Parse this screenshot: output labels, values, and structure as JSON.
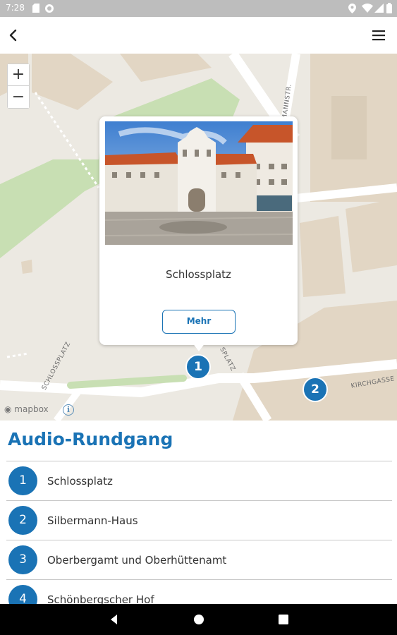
{
  "status_bar": {
    "time": "7:28"
  },
  "map": {
    "streets": [
      "SCHLOSSPLATZ",
      "SPLATZ",
      "KIRCHGASSE",
      "RMANNSTR."
    ],
    "attribution": "mapbox",
    "markers": [
      {
        "label": "1"
      },
      {
        "label": "2"
      }
    ]
  },
  "popup": {
    "title": "Schlossplatz",
    "more_label": "Mehr"
  },
  "tour": {
    "title": "Audio-Rundgang",
    "items": [
      {
        "number": "1",
        "label": "Schlossplatz"
      },
      {
        "number": "2",
        "label": "Silbermann-Haus"
      },
      {
        "number": "3",
        "label": "Oberbergamt und Oberhüttenamt"
      },
      {
        "number": "4",
        "label": "Schönbergscher Hof"
      }
    ]
  },
  "colors": {
    "accent": "#1a73b5",
    "map_background": "#ece9e2",
    "park": "#c8dfb3"
  }
}
